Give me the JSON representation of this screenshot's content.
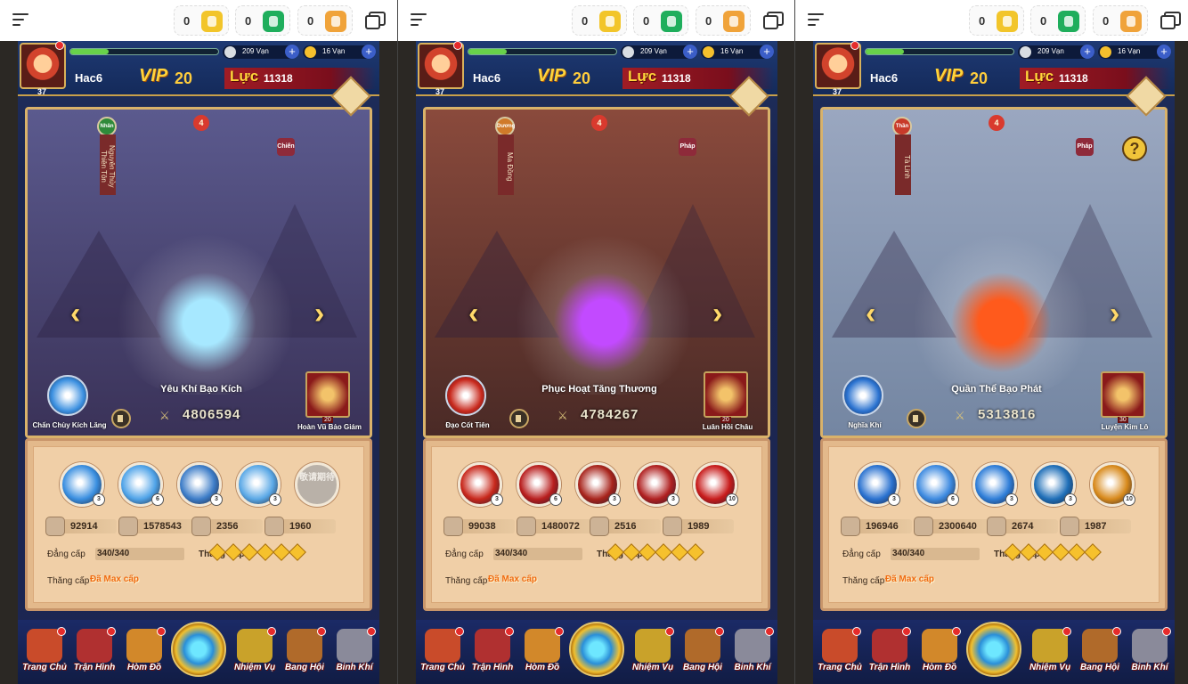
{
  "panels": [
    {
      "topbar": {
        "currencies": [
          "0",
          "0",
          "0"
        ]
      },
      "header": {
        "level": "37",
        "name": "Hac6",
        "vip_label": "VIP",
        "vip_level": "20",
        "luc_label": "Lực",
        "luc_value": "11318",
        "silver": "209 Vạn",
        "gold": "16 Vạn"
      },
      "hero": {
        "faction": "Nhân",
        "title_ribbon": "Nguyên Thủy Thiên Tôn",
        "class": "Chiến",
        "star": "4",
        "skill_name": "Yêu Khí Bạo Kích",
        "power": "4806594",
        "left_skill": "Chấn Chùy Kích Lăng",
        "right_skill": "Hoàn Vũ Bảo Giám",
        "right_skill_level": "20",
        "colors": {
          "sky": "#5b5a8e",
          "ground": "#3a3258",
          "glow": "#a7e8ff"
        }
      },
      "skills": [
        {
          "level": "3",
          "color": "#3a8fe0"
        },
        {
          "level": "6",
          "color": "#4fa3e8"
        },
        {
          "level": "3",
          "color": "#3d7dc8"
        },
        {
          "level": "3",
          "color": "#5aa8e6"
        },
        {
          "locked": true,
          "label": "敬请期待"
        }
      ],
      "stats": [
        "92914",
        "1578543",
        "2356",
        "1960"
      ],
      "level_label": "Đẳng cấp",
      "level_value": "340/340",
      "rank_label": "Thăng Cấp",
      "upgrade_label": "Thăng cấp",
      "upgrade_value": "Đã Max cấp"
    },
    {
      "topbar": {
        "currencies": [
          "0",
          "0",
          "0"
        ]
      },
      "header": {
        "level": "37",
        "name": "Hac6",
        "vip_label": "VIP",
        "vip_level": "20",
        "luc_label": "Lực",
        "luc_value": "11318",
        "silver": "209 Vạn",
        "gold": "16 Vạn"
      },
      "hero": {
        "faction": "Dương",
        "title_ribbon": "Ma Đồng",
        "class": "Pháp",
        "star": "4",
        "skill_name": "Phục Hoạt Tăng Thương",
        "power": "4784267",
        "left_skill": "Đạo Cốt Tiên",
        "right_skill": "Luân Hồi Châu",
        "right_skill_level": "20",
        "colors": {
          "sky": "#8a4a3c",
          "ground": "#4a2a26",
          "glow": "#c24aff"
        }
      },
      "skills": [
        {
          "level": "3",
          "color": "#c8281c"
        },
        {
          "level": "6",
          "color": "#b81e1e"
        },
        {
          "level": "3",
          "color": "#a8241c"
        },
        {
          "level": "3",
          "color": "#b02020"
        },
        {
          "level": "10",
          "color": "#c81c1c"
        }
      ],
      "stats": [
        "99038",
        "1480072",
        "2516",
        "1989"
      ],
      "level_label": "Đẳng cấp",
      "level_value": "340/340",
      "rank_label": "Thăng Cấp",
      "upgrade_label": "Thăng cấp",
      "upgrade_value": "Đã Max cấp"
    },
    {
      "topbar": {
        "currencies": [
          "0",
          "0",
          "0"
        ]
      },
      "header": {
        "level": "37",
        "name": "Hac6",
        "vip_label": "VIP",
        "vip_level": "20",
        "luc_label": "Lực",
        "luc_value": "11318",
        "silver": "209 Vạn",
        "gold": "16 Vạn"
      },
      "hero": {
        "faction": "Thần",
        "title_ribbon": "Tà Linh",
        "class": "Pháp",
        "star": "4",
        "skill_name": "Quần Thể Bạo Phát",
        "power": "5313816",
        "left_skill": "Nghĩa Khí",
        "right_skill": "Luyện Kim Lô",
        "right_skill_level": "30",
        "colors": {
          "sky": "#9aa7c0",
          "ground": "#7486a2",
          "glow": "#ff5a1c"
        }
      },
      "skills": [
        {
          "level": "3",
          "color": "#2a72d0"
        },
        {
          "level": "6",
          "color": "#3d8ae0"
        },
        {
          "level": "3",
          "color": "#2f7ed8"
        },
        {
          "level": "3",
          "color": "#1f6fb8"
        },
        {
          "level": "10",
          "color": "#d88a1c"
        }
      ],
      "stats": [
        "196946",
        "2300640",
        "2674",
        "1987"
      ],
      "level_label": "Đẳng cấp",
      "level_value": "340/340",
      "rank_label": "Thăng Cấp",
      "upgrade_label": "Thăng cấp",
      "upgrade_value": "Đã Max cấp"
    }
  ],
  "bottom_nav": [
    "Trang Chủ",
    "Trận Hình",
    "Hòm Đồ",
    "Nhiệm Vụ",
    "Bang Hội",
    "Binh Khí"
  ]
}
